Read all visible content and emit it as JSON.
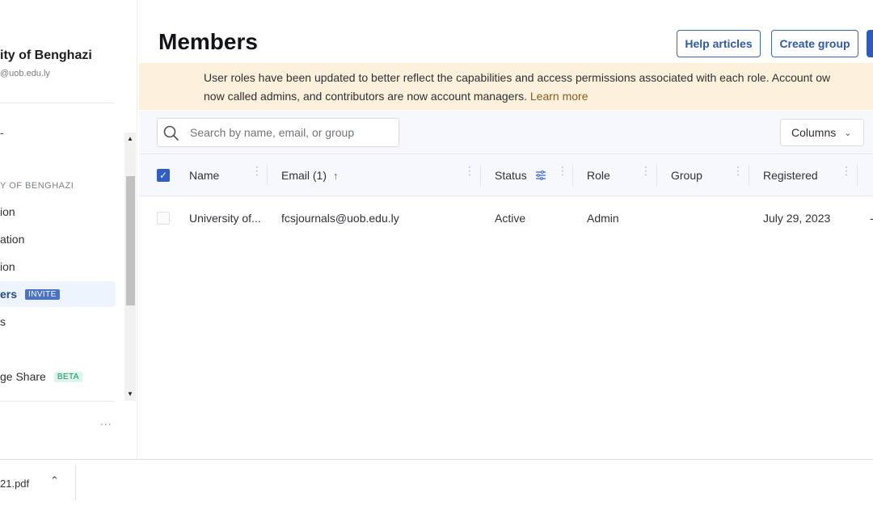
{
  "sidebar": {
    "org_name": "ity of Benghazi",
    "org_email": "@uob.edu.ly",
    "dash_item": "-",
    "section_label": "Y OF BENGHAZI",
    "items": [
      {
        "label": "ion"
      },
      {
        "label": "ation"
      },
      {
        "label": "ion"
      },
      {
        "label": "ers",
        "badge": "INVITE",
        "active": true
      },
      {
        "label": "s"
      },
      {
        "label": "ge Share",
        "badge": "BETA"
      }
    ],
    "more_label": "∙∙∙"
  },
  "header": {
    "title": "Members",
    "help_articles_label": "Help articles",
    "create_group_label": "Create group"
  },
  "banner": {
    "line1": "User roles have been updated to better reflect the capabilities and access permissions associated with each role. Account ow",
    "line2_prefix": "now called admins, and contributors are now account managers. ",
    "learn_more": "Learn more"
  },
  "toolbar": {
    "search_placeholder": "Search by name, email, or group",
    "columns_label": "Columns"
  },
  "table": {
    "columns": {
      "name": "Name",
      "email": "Email (1)",
      "status": "Status",
      "role": "Role",
      "group": "Group",
      "registered": "Registered"
    },
    "rows": [
      {
        "name": "University of...",
        "email": "fcsjournals@uob.edu.ly",
        "status": "Active",
        "role": "Admin",
        "group": "",
        "registered": "July 29, 2023",
        "extra": "-"
      }
    ]
  },
  "downloads": {
    "file_name": "21.pdf"
  },
  "colors": {
    "accent": "#2f5fc6",
    "banner_bg": "#fdf1db",
    "beta_green": "#1d8f62"
  }
}
